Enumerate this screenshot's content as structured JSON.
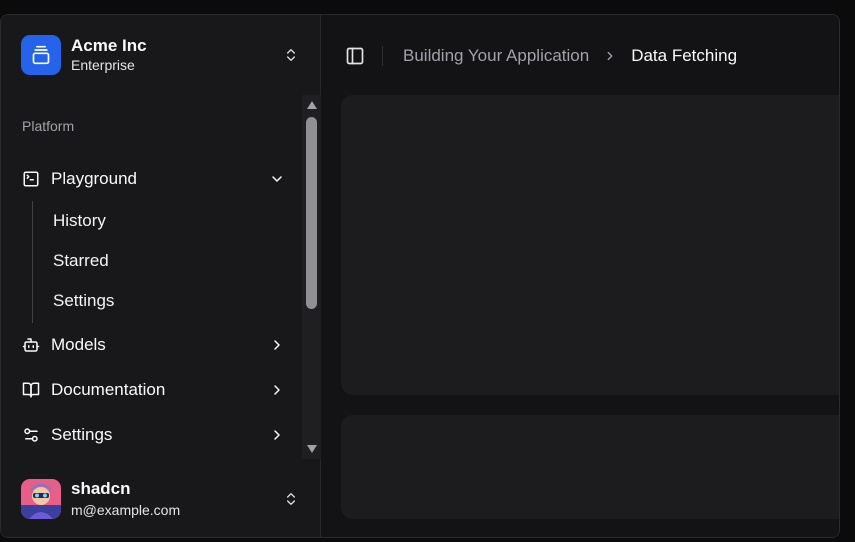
{
  "team": {
    "name": "Acme Inc",
    "plan": "Enterprise"
  },
  "sidebar": {
    "group_label": "Platform",
    "playground": {
      "label": "Playground",
      "subitems": [
        "History",
        "Starred",
        "Settings"
      ]
    },
    "items": [
      {
        "label": "Models",
        "icon": "bot-icon"
      },
      {
        "label": "Documentation",
        "icon": "book-open-icon"
      },
      {
        "label": "Settings",
        "icon": "settings-sliders-icon"
      }
    ]
  },
  "user": {
    "name": "shadcn",
    "email": "m@example.com"
  },
  "breadcrumb": {
    "parent": "Building Your Application",
    "current": "Data Fetching"
  },
  "colors": {
    "accent": "#2563eb",
    "sidebar_bg": "#18181b",
    "card_bg": "#1c1c1e"
  }
}
